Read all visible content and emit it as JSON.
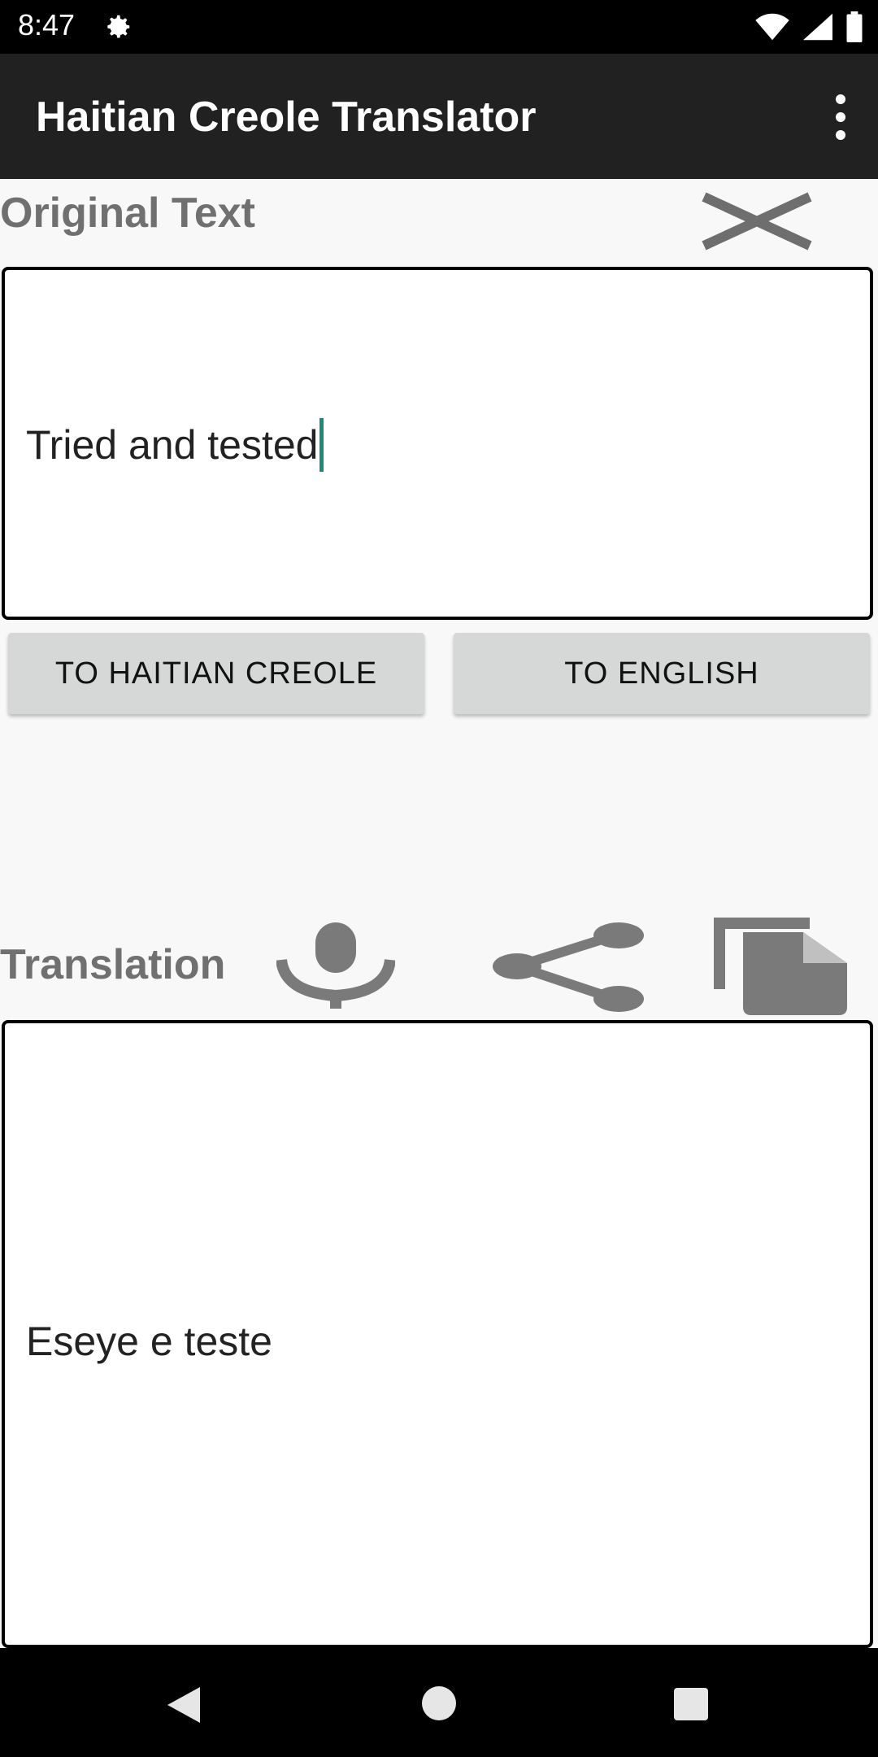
{
  "status_bar": {
    "time": "8:47",
    "icons": [
      "gear-icon",
      "wifi-icon",
      "signal-icon",
      "battery-icon"
    ]
  },
  "app_bar": {
    "title": "Haitian Creole Translator",
    "menu_icon": "overflow-menu-icon"
  },
  "original": {
    "label": "Original Text",
    "input_value": "Tried and tested",
    "clear_icon": "close-icon"
  },
  "buttons": {
    "to_haitian_creole": "TO HAITIAN CREOLE",
    "to_english": "TO ENGLISH"
  },
  "translation": {
    "label": "Translation",
    "output_value": "Eseye e teste",
    "icons": [
      "microphone-icon",
      "share-icon",
      "copy-icon"
    ]
  },
  "nav_bar": {
    "icons": [
      "back-icon",
      "home-icon",
      "recents-icon"
    ]
  },
  "colors": {
    "app_bar": "#212121",
    "icon_gray": "#7a7a7a",
    "button_bg": "#d6d7d7",
    "caret": "#1d8a7a"
  }
}
